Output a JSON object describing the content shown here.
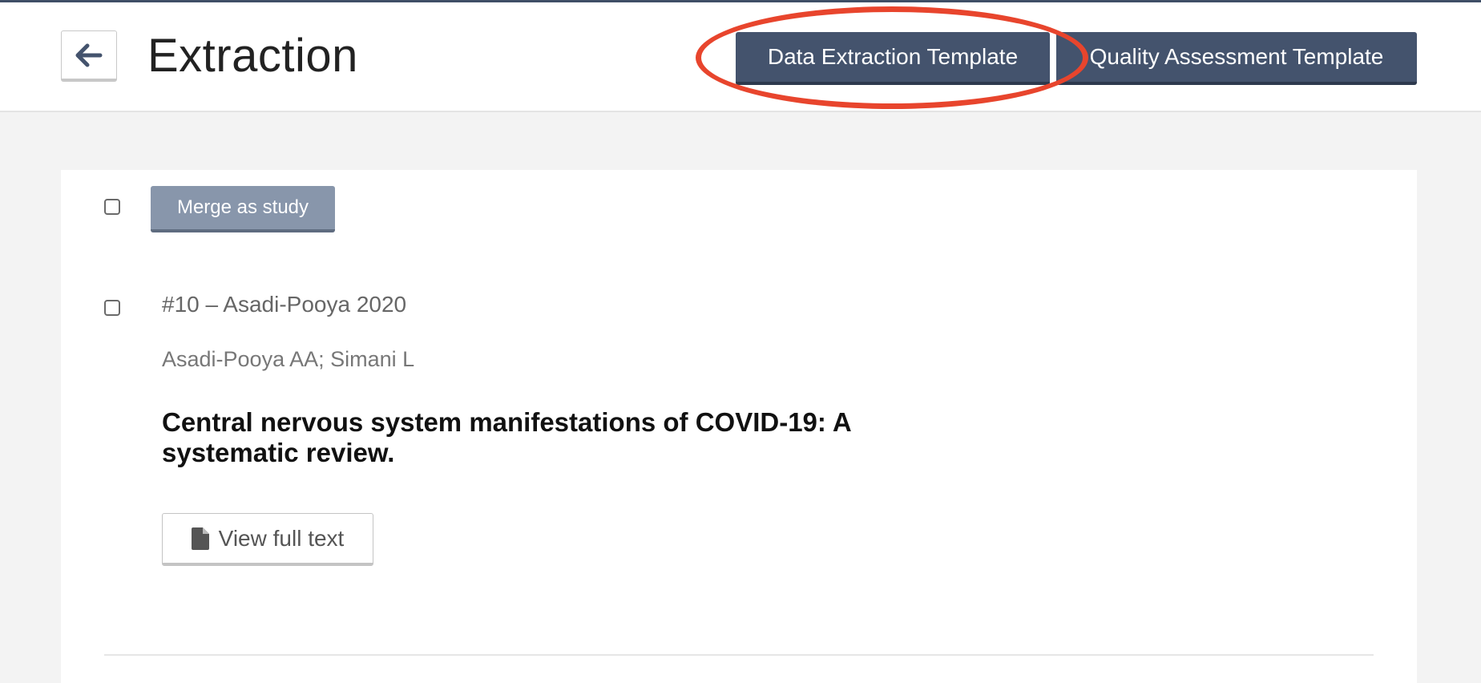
{
  "header": {
    "title": "Extraction",
    "back_icon": "arrow-left-icon",
    "data_extraction_label": "Data Extraction Template",
    "quality_assessment_label": "Quality Assessment Template"
  },
  "annotation": {
    "highlight_color": "#e8452d"
  },
  "toolbar": {
    "merge_label": "Merge as study"
  },
  "reference": {
    "id_label": "#10 – Asadi-Pooya 2020",
    "authors": "Asadi-Pooya AA; Simani L",
    "title": "Central nervous system manifestations of COVID-19: A systematic review.",
    "full_text_label": "View full text",
    "full_text_icon": "document-icon"
  },
  "colors": {
    "primary": "#44536d",
    "disabled": "#8896ab"
  }
}
